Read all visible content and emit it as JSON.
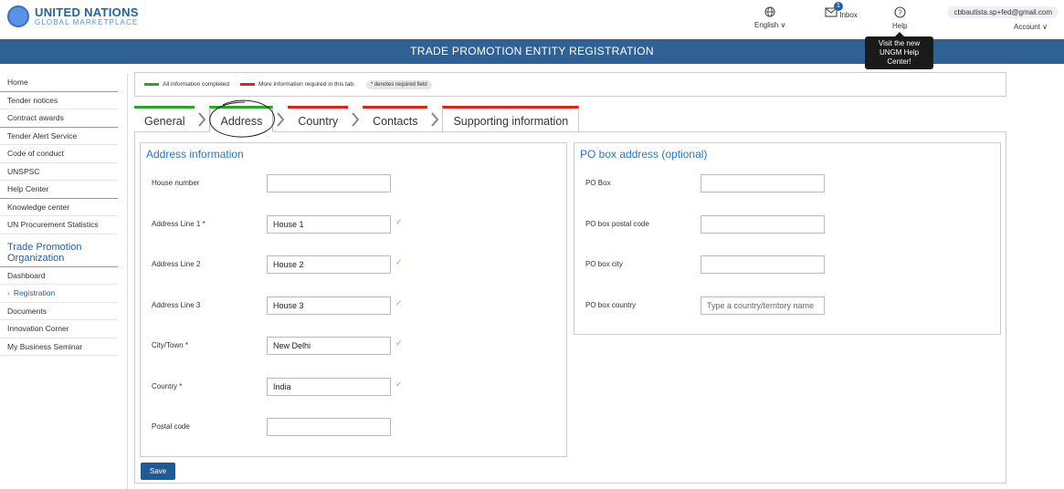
{
  "header": {
    "logo_title": "UNITED NATIONS",
    "logo_subtitle": "GLOBAL MARKETPLACE",
    "language": "English ∨",
    "inbox_label": "Inbox",
    "inbox_count": "1",
    "help_label": "Help",
    "account_email": "cbbautista.sp+fed@gmail.com",
    "account_label": "Account ∨"
  },
  "tooltip": {
    "line1": "Visit the new",
    "line2": "UNGM Help",
    "line3": "Center!"
  },
  "titlebar": "TRADE PROMOTION ENTITY REGISTRATION",
  "sidebar": {
    "items": [
      "Home",
      "Tender notices",
      "Contract awards",
      "Tender Alert Service",
      "Code of conduct",
      "UNSPSC",
      "Help Center",
      "Knowledge center",
      "UN Procurement Statistics"
    ],
    "section_title": "Trade Promotion Organization",
    "section_items": [
      "Dashboard",
      "Registration",
      "Documents",
      "Innovation Corner",
      "My Business Seminar"
    ]
  },
  "legend": {
    "complete": "All information completed",
    "incomplete": "More information required in this tab.",
    "required": "* denotes required field"
  },
  "tabs": [
    "General",
    "Address",
    "Country",
    "Contacts",
    "Supporting information"
  ],
  "address": {
    "title": "Address information",
    "fields": [
      {
        "label": "House number",
        "value": ""
      },
      {
        "label": "Address Line 1 *",
        "value": "House 1"
      },
      {
        "label": "Address Line 2",
        "value": "House 2"
      },
      {
        "label": "Address Line 3",
        "value": "House 3"
      },
      {
        "label": "City/Town *",
        "value": "New Delhi"
      },
      {
        "label": "Country *",
        "value": "India"
      },
      {
        "label": "Postal code",
        "value": ""
      }
    ]
  },
  "pobox": {
    "title": "PO box address (optional)",
    "fields": [
      {
        "label": "PO Box",
        "value": ""
      },
      {
        "label": "PO box postal code",
        "value": ""
      },
      {
        "label": "PO box city",
        "value": ""
      },
      {
        "label": "PO box country",
        "value": "",
        "placeholder": "Type a country/territory name"
      }
    ]
  },
  "save_label": "Save",
  "colors": {
    "complete": "#2aa52a",
    "incomplete": "#e2231a",
    "brand": "#2f6195"
  },
  "check_mark": "✓"
}
